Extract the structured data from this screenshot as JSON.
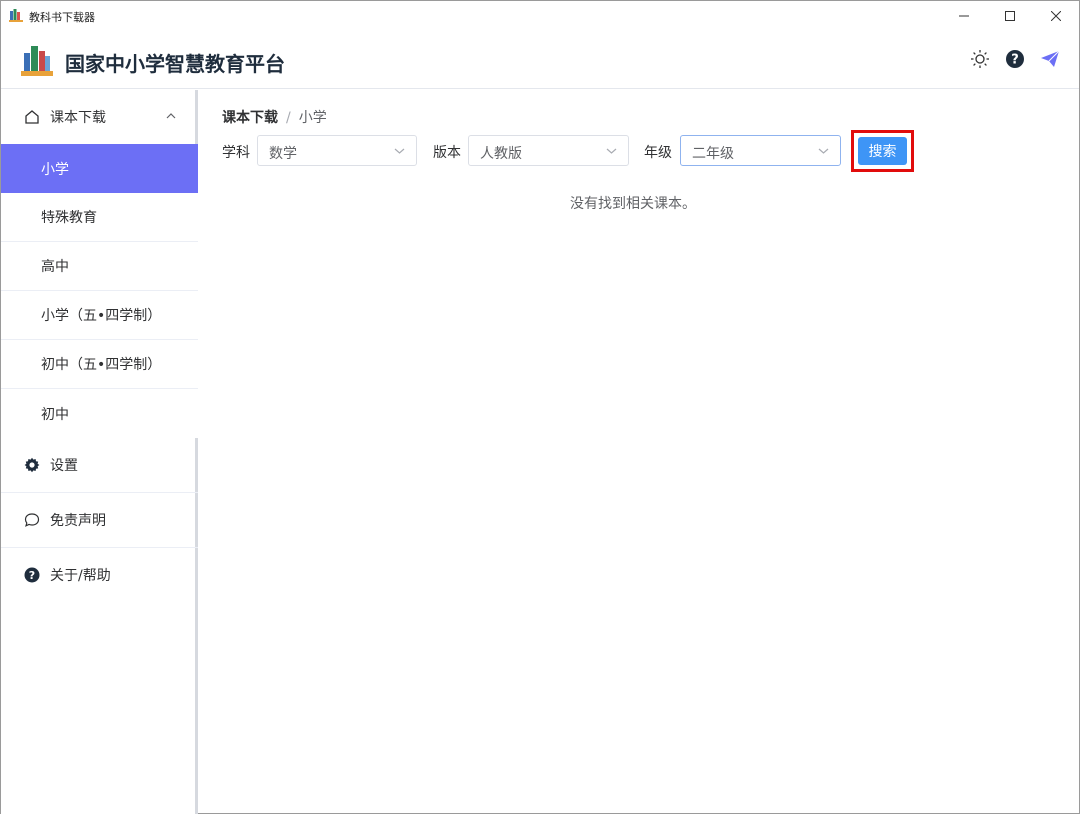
{
  "window": {
    "title": "教科书下载器"
  },
  "header": {
    "app_name": "国家中小学智慧教育平台"
  },
  "sidebar": {
    "group_label": "课本下载",
    "sub_items": [
      "小学",
      "特殊教育",
      "高中",
      "小学（五•四学制）",
      "初中（五•四学制）",
      "初中"
    ],
    "active_item": "小学",
    "settings_label": "设置",
    "disclaimer_label": "免责声明",
    "about_label": "关于/帮助"
  },
  "breadcrumb": {
    "root": "课本下载",
    "separator": "/",
    "current": "小学"
  },
  "filters": {
    "subject_label": "学科",
    "subject_value": "数学",
    "edition_label": "版本",
    "edition_value": "人教版",
    "grade_label": "年级",
    "grade_value": "二年级"
  },
  "search_button": {
    "label": "搜索"
  },
  "empty_message": "没有找到相关课本。",
  "colors": {
    "accent": "#6c6ff5",
    "button": "#3e95f6",
    "highlight_border": "#e10c0c"
  }
}
